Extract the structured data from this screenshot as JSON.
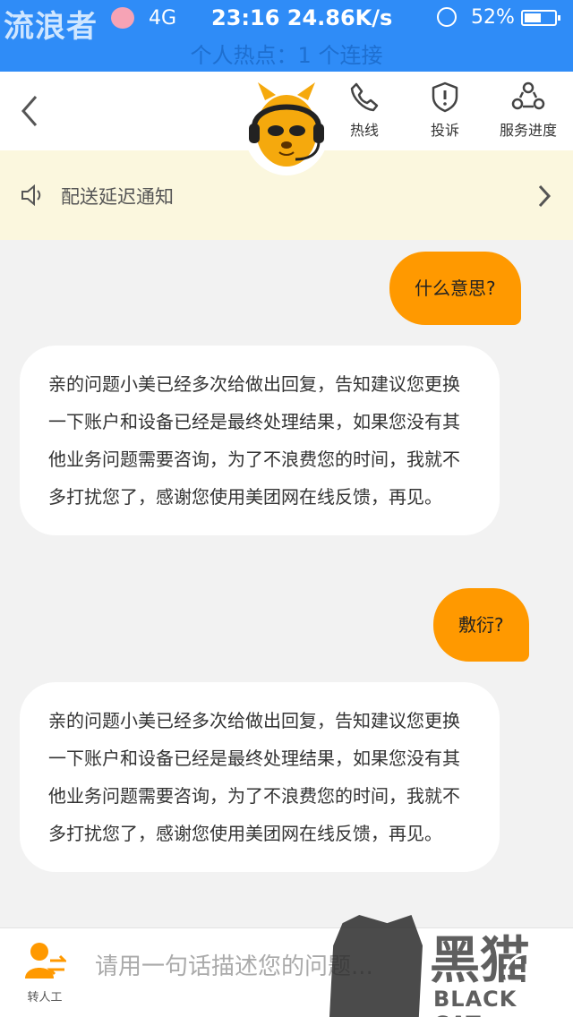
{
  "status_bar": {
    "carrier": "流浪者",
    "network": "4G",
    "time_speed": "23:16 24.86K/s",
    "battery": "52%"
  },
  "hotspot_banner": "个人热点：1 个连接",
  "header": {
    "actions": [
      {
        "label": "热线",
        "icon": "phone-icon"
      },
      {
        "label": "投诉",
        "icon": "shield-alert-icon"
      },
      {
        "label": "服务进度",
        "icon": "progress-icon"
      }
    ]
  },
  "notice": {
    "text": "配送延迟通知"
  },
  "messages": [
    {
      "from": "user",
      "text": "什么意思?"
    },
    {
      "from": "agent",
      "text": "亲的问题小美已经多次给做出回复，告知建议您更换一下账户和设备已经是最终处理结果，如果您没有其他业务问题需要咨询，为了不浪费您的时间，我就不多打扰您了，感谢您使用美团网在线反馈，再见。"
    },
    {
      "from": "user",
      "text": "敷衍?"
    },
    {
      "from": "agent",
      "text": "亲的问题小美已经多次给做出回复，告知建议您更换一下账户和设备已经是最终处理结果，如果您没有其他业务问题需要咨询，为了不浪费您的时间，我就不多打扰您了，感谢您使用美团网在线反馈，再见。"
    }
  ],
  "input_bar": {
    "transfer_label": "转人工",
    "placeholder": "请用一句话描述您的问题..."
  },
  "watermark": {
    "cn": "黑猫",
    "en": "BLACK CAT"
  },
  "colors": {
    "status_bar": "#2f8cf7",
    "accent": "#ff9900",
    "notice_bg": "#fbf7de",
    "chat_bg": "#f2f2f2"
  }
}
